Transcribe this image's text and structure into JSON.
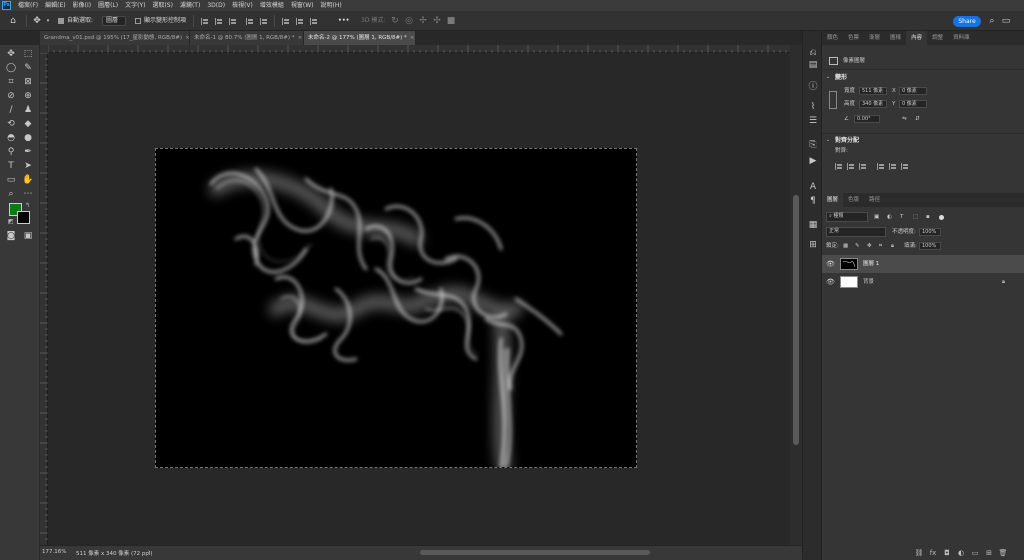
{
  "app": {
    "logo": "Ps"
  },
  "menu": [
    "檔案(F)",
    "編輯(E)",
    "影像(I)",
    "圖層(L)",
    "文字(Y)",
    "選取(S)",
    "濾鏡(T)",
    "3D(D)",
    "檢視(V)",
    "增效模組",
    "視窗(W)",
    "說明(H)"
  ],
  "options": {
    "auto_select_label": "自動選取:",
    "auto_select_value": "圖層",
    "show_transform_label": "顯示變形控制項",
    "mode_3d_label": "3D 模式:",
    "more": "•••",
    "share": "Share"
  },
  "tabs": [
    {
      "label": "Grandma_v01.psd @ 195% (17_星影動態, RGB/8#)",
      "close": "×",
      "active": false
    },
    {
      "label": "未命名-1 @ 80.7% (圖層 1, RGB/8#) *",
      "close": "×",
      "active": false
    },
    {
      "label": "未命名-2 @ 177% (圖層 1, RGB/8#) *",
      "close": "×",
      "active": true
    }
  ],
  "status": {
    "zoom": "177.16%",
    "doc_info": "511 像素 x 340 像素 (72 ppi)"
  },
  "properties_tabs": [
    "顏色",
    "色票",
    "漸層",
    "圖樣",
    "內容",
    "調整",
    "資料庫"
  ],
  "properties": {
    "pixel_layer_label": "像素圖層",
    "transform_title": "變形",
    "width_label": "寬度",
    "width_value": "511 像素",
    "x_label": "X",
    "x_value": "0 像素",
    "height_label": "高度",
    "height_value": "340 像素",
    "y_label": "Y",
    "y_value": "0 像素",
    "angle_value": "0.00°",
    "align_title": "對齊分配",
    "align_label": "對齊:"
  },
  "layers_tabs": [
    "圖層",
    "色版",
    "路徑"
  ],
  "layers": {
    "filter_kind": "種類",
    "blend_mode": "正常",
    "opacity_label": "不透明度:",
    "opacity_value": "100%",
    "lock_label": "鎖定:",
    "fill_label": "填滿:",
    "fill_value": "100%",
    "items": [
      {
        "name": "圖層 1",
        "selected": true
      },
      {
        "name": "背景",
        "selected": false
      }
    ]
  },
  "colors": {
    "foreground": "#0b7a12",
    "background": "#000000",
    "accent": "#1473e6"
  }
}
